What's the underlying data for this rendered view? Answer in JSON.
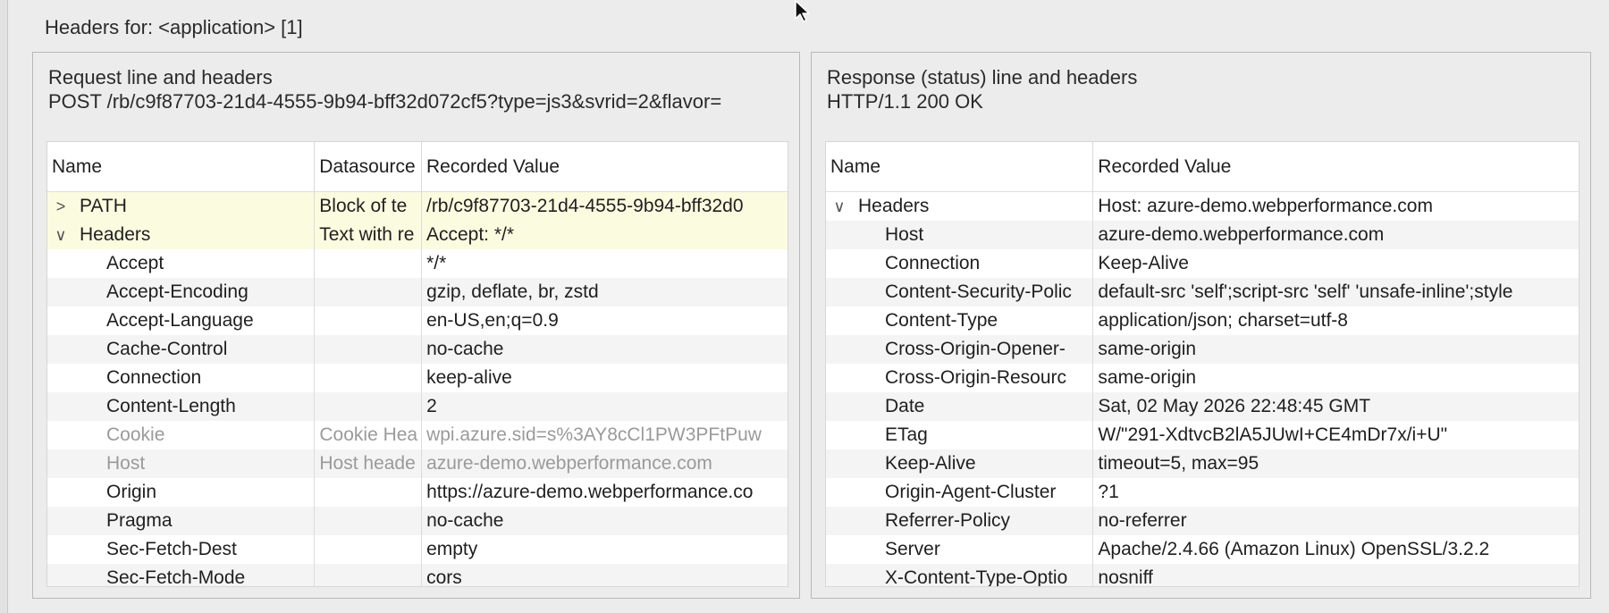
{
  "outer_title": "Headers for: <application> [1]",
  "request": {
    "title": "Request line and headers",
    "line": "POST /rb/c9f87703-21d4-4555-9b94-bff32d072cf5?type=js3&svrid=2&flavor=",
    "columns": [
      "Name",
      "Datasource",
      "Recorded Value"
    ],
    "rows": [
      {
        "name": "PATH",
        "toggle": ">",
        "ds": "Block of te",
        "value": "/rb/c9f87703-21d4-4555-9b94-bff32d0",
        "style": "hl top"
      },
      {
        "name": "Headers",
        "toggle": "∨",
        "ds": "Text with re",
        "value": "Accept: */*",
        "style": "hl top"
      },
      {
        "name": "Accept",
        "ds": "",
        "value": "*/*",
        "style": ""
      },
      {
        "name": "Accept-Encoding",
        "ds": "",
        "value": "gzip, deflate, br, zstd",
        "style": "alt"
      },
      {
        "name": "Accept-Language",
        "ds": "",
        "value": "en-US,en;q=0.9",
        "style": ""
      },
      {
        "name": "Cache-Control",
        "ds": "",
        "value": "no-cache",
        "style": "alt"
      },
      {
        "name": "Connection",
        "ds": "",
        "value": "keep-alive",
        "style": ""
      },
      {
        "name": "Content-Length",
        "ds": "",
        "value": "2",
        "style": "alt"
      },
      {
        "name": "Cookie",
        "ds": "Cookie Hea",
        "value": "wpi.azure.sid=s%3AY8cCl1PW3PFtPuw",
        "style": "dim"
      },
      {
        "name": "Host",
        "ds": "Host heade",
        "value": "azure-demo.webperformance.com",
        "style": "dim alt"
      },
      {
        "name": "Origin",
        "ds": "",
        "value": "https://azure-demo.webperformance.co",
        "style": ""
      },
      {
        "name": "Pragma",
        "ds": "",
        "value": "no-cache",
        "style": "alt"
      },
      {
        "name": "Sec-Fetch-Dest",
        "ds": "",
        "value": "empty",
        "style": ""
      },
      {
        "name": "Sec-Fetch-Mode",
        "ds": "",
        "value": "cors",
        "style": "alt"
      }
    ]
  },
  "response": {
    "title": "Response (status) line and headers",
    "line": "HTTP/1.1 200 OK",
    "columns": [
      "Name",
      "Recorded Value"
    ],
    "rows": [
      {
        "name": "Headers",
        "toggle": "∨",
        "value": "Host: azure-demo.webperformance.com",
        "style": "top"
      },
      {
        "name": "Host",
        "value": "azure-demo.webperformance.com",
        "style": "alt"
      },
      {
        "name": "Connection",
        "value": "Keep-Alive",
        "style": ""
      },
      {
        "name": "Content-Security-Polic",
        "value": "default-src 'self';script-src 'self' 'unsafe-inline';style",
        "style": "alt"
      },
      {
        "name": "Content-Type",
        "value": "application/json; charset=utf-8",
        "style": ""
      },
      {
        "name": "Cross-Origin-Opener-",
        "value": "same-origin",
        "style": "alt"
      },
      {
        "name": "Cross-Origin-Resourc",
        "value": "same-origin",
        "style": ""
      },
      {
        "name": "Date",
        "value": "Sat, 02 May 2026 22:48:45 GMT",
        "style": "alt"
      },
      {
        "name": "ETag",
        "value": "W/\"291-XdtvcB2lA5JUwI+CE4mDr7x/i+U\"",
        "style": ""
      },
      {
        "name": "Keep-Alive",
        "value": "timeout=5, max=95",
        "style": "alt"
      },
      {
        "name": "Origin-Agent-Cluster",
        "value": "?1",
        "style": ""
      },
      {
        "name": "Referrer-Policy",
        "value": "no-referrer",
        "style": "alt"
      },
      {
        "name": "Server",
        "value": "Apache/2.4.66 (Amazon Linux) OpenSSL/3.2.2",
        "style": ""
      },
      {
        "name": "X-Content-Type-Optio",
        "value": "nosniff",
        "style": "alt"
      }
    ]
  },
  "icons": {
    "expand": "chevron-right-icon",
    "collapse": "chevron-down-icon",
    "cursor": "mouse-pointer-icon"
  }
}
